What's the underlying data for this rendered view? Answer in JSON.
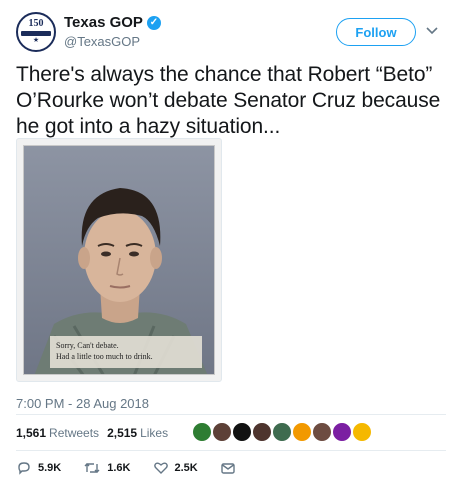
{
  "account": {
    "logo_text": "150",
    "name": "Texas GOP",
    "handle": "@TexasGOP",
    "verified": true
  },
  "header": {
    "follow_label": "Follow",
    "more_icon": "chevron-down-icon"
  },
  "tweet": {
    "text": "There's always the chance that Robert “Beto” O’Rourke won’t debate Senator Cruz because he got into a hazy situation...",
    "image_caption_line1": "Sorry, Can't debate.",
    "image_caption_line2": "Had a little too much to drink.",
    "timestamp": "7:00 PM - 28 Aug 2018"
  },
  "stats": {
    "retweets_count": "1,561",
    "retweets_label": "Retweets",
    "likes_count": "2,515",
    "likes_label": "Likes",
    "avatar_colors": [
      "#2e7d32",
      "#5d4037",
      "#111111",
      "#4e342e",
      "#3e6b4f",
      "#f29900",
      "#6d4c41",
      "#7b1fa2",
      "#f5b800"
    ]
  },
  "actions": {
    "reply_count": "5.9K",
    "retweet_count": "1.6K",
    "like_count": "2.5K"
  },
  "colors": {
    "accent": "#1da1f2",
    "text": "#14171a",
    "muted": "#657786"
  }
}
